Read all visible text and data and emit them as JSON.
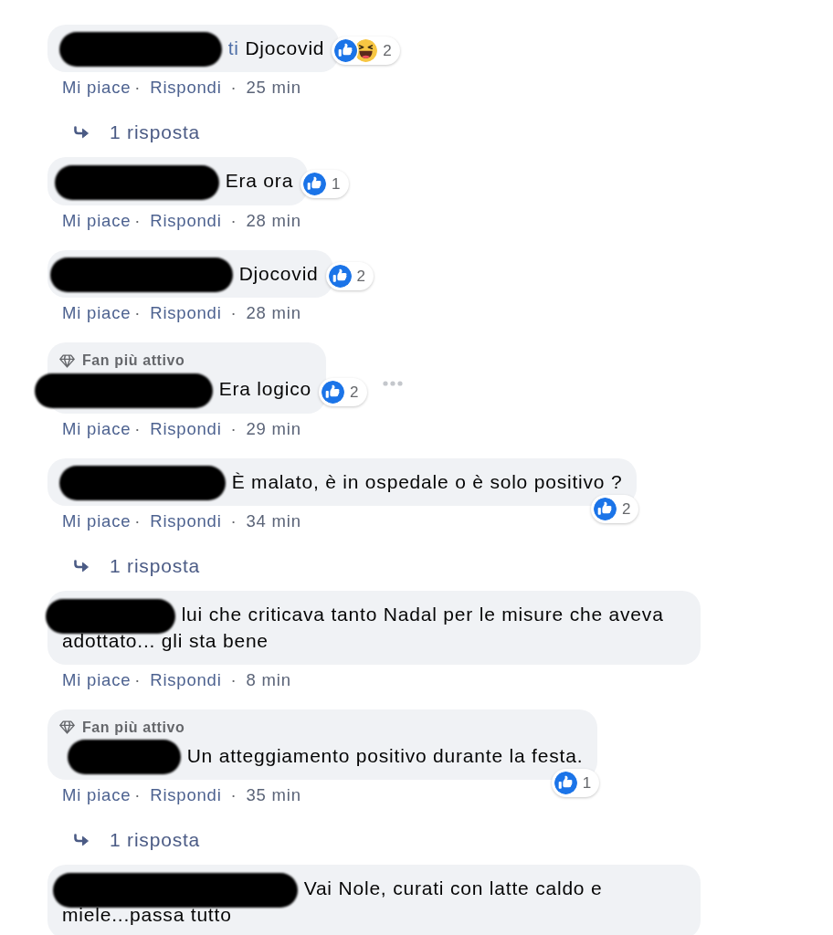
{
  "separator": "·",
  "comments": [
    {
      "author_redacted": true,
      "author_visible": "ti",
      "text": "Djocovid",
      "reactions": {
        "items": [
          {
            "kind": "like"
          },
          {
            "kind": "haha"
          }
        ],
        "count": "2"
      },
      "actions": [
        "Mi piace",
        "Rispondi"
      ],
      "time": "25 min",
      "menu_visible": false,
      "replies": "1 risposta"
    },
    {
      "author_redacted": true,
      "text": "Era ora",
      "reactions": {
        "items": [
          {
            "kind": "like"
          }
        ],
        "count": "1"
      },
      "actions": [
        "Mi piace",
        "Rispondi"
      ],
      "time": "28 min",
      "menu_visible": false
    },
    {
      "author_redacted": true,
      "text": "Djocovid",
      "reactions": {
        "items": [
          {
            "kind": "like"
          }
        ],
        "count": "2"
      },
      "actions": [
        "Mi piace",
        "Rispondi"
      ],
      "time": "28 min",
      "menu_visible": false
    },
    {
      "badge": "Fan più attivo",
      "author_redacted": true,
      "text": "Era logico",
      "reactions": {
        "items": [
          {
            "kind": "like"
          }
        ],
        "count": "2"
      },
      "actions": [
        "Mi piace",
        "Rispondi"
      ],
      "time": "29 min",
      "menu_visible": true
    },
    {
      "author_redacted": true,
      "text": "È malato, è in ospedale o è solo positivo ?",
      "reactions": {
        "items": [
          {
            "kind": "like"
          }
        ],
        "count": "2"
      },
      "actions": [
        "Mi piace",
        "Rispondi"
      ],
      "time": "34 min",
      "menu_visible": false,
      "replies": "1 risposta"
    },
    {
      "author_redacted": true,
      "text": "lui che criticava tanto Nadal per le misure che aveva adottato... gli sta bene",
      "actions": [
        "Mi piace",
        "Rispondi"
      ],
      "time": "8 min",
      "menu_visible": false
    },
    {
      "badge": "Fan più attivo",
      "author_redacted": true,
      "text": "Un atteggiamento positivo durante la festa.",
      "reactions": {
        "items": [
          {
            "kind": "like"
          }
        ],
        "count": "1"
      },
      "actions": [
        "Mi piace",
        "Rispondi"
      ],
      "time": "35 min",
      "menu_visible": false,
      "replies": "1 risposta"
    },
    {
      "author_redacted": true,
      "text": "Vai Nole, curati con latte caldo e miele...passa tutto",
      "menu_visible": false
    }
  ]
}
